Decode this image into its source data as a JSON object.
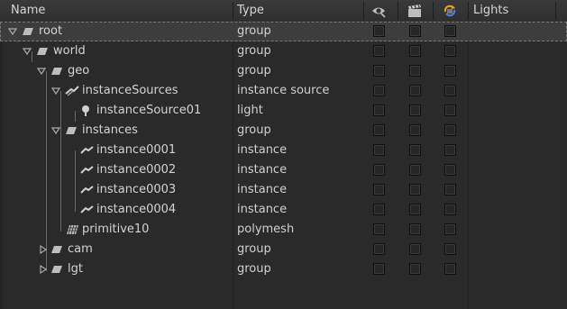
{
  "header": {
    "name": "Name",
    "type": "Type",
    "lights": "Lights",
    "icons": [
      "eye-visibility-icon",
      "clapperboard-render-icon",
      "refresh-update-icon"
    ]
  },
  "rows": [
    {
      "name": "root",
      "type": "group",
      "icon": "group",
      "expanded": true,
      "selected": true
    },
    {
      "name": "world",
      "type": "group",
      "icon": "group",
      "expanded": true
    },
    {
      "name": "geo",
      "type": "group",
      "icon": "group",
      "expanded": true
    },
    {
      "name": "instanceSources",
      "type": "instance source",
      "icon": "instance-source",
      "expanded": true
    },
    {
      "name": "instanceSource01",
      "type": "light",
      "icon": "light"
    },
    {
      "name": "instances",
      "type": "group",
      "icon": "group",
      "expanded": true
    },
    {
      "name": "instance0001",
      "type": "instance",
      "icon": "instance"
    },
    {
      "name": "instance0002",
      "type": "instance",
      "icon": "instance"
    },
    {
      "name": "instance0003",
      "type": "instance",
      "icon": "instance"
    },
    {
      "name": "instance0004",
      "type": "instance",
      "icon": "instance"
    },
    {
      "name": "primitive10",
      "type": "polymesh",
      "icon": "polymesh"
    },
    {
      "name": "cam",
      "type": "group",
      "icon": "group",
      "expanded": false
    },
    {
      "name": "lgt",
      "type": "group",
      "icon": "group",
      "expanded": false
    }
  ],
  "colors": {
    "selected_row": "#3d3d3d",
    "background": "#2a2a2a",
    "update_icon": "#e6a81e"
  }
}
